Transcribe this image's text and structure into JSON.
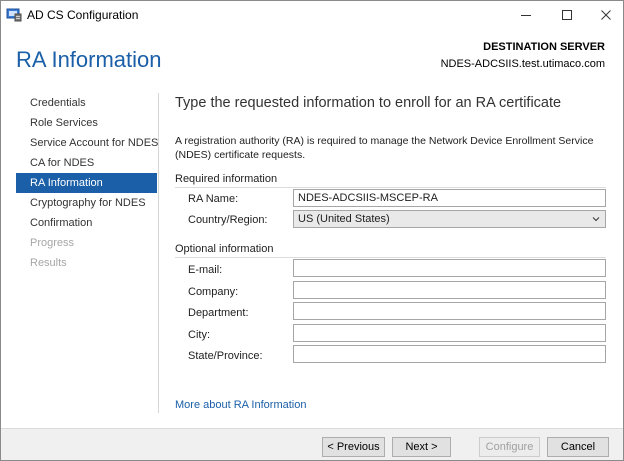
{
  "window": {
    "title": "AD CS Configuration"
  },
  "header": {
    "page_title": "RA Information",
    "destination_label": "DESTINATION SERVER",
    "destination_server": "NDES-ADCSIIS.test.utimaco.com"
  },
  "sidebar": {
    "items": [
      {
        "label": "Credentials",
        "state": "normal"
      },
      {
        "label": "Role Services",
        "state": "normal"
      },
      {
        "label": "Service Account for NDES",
        "state": "normal"
      },
      {
        "label": "CA for NDES",
        "state": "normal"
      },
      {
        "label": "RA Information",
        "state": "active"
      },
      {
        "label": "Cryptography for NDES",
        "state": "normal"
      },
      {
        "label": "Confirmation",
        "state": "normal"
      },
      {
        "label": "Progress",
        "state": "disabled"
      },
      {
        "label": "Results",
        "state": "disabled"
      }
    ]
  },
  "main": {
    "heading": "Type the requested information to enroll for an RA certificate",
    "description": "A registration authority (RA) is required to manage the Network Device Enrollment Service (NDES) certificate requests.",
    "required": {
      "section_label": "Required information",
      "ra_name_label": "RA Name:",
      "ra_name_value": "NDES-ADCSIIS-MSCEP-RA",
      "country_label": "Country/Region:",
      "country_value": "US (United States)"
    },
    "optional": {
      "section_label": "Optional information",
      "email_label": "E-mail:",
      "email_value": "",
      "company_label": "Company:",
      "company_value": "",
      "department_label": "Department:",
      "department_value": "",
      "city_label": "City:",
      "city_value": "",
      "state_label": "State/Province:",
      "state_value": ""
    },
    "more_link": "More about RA Information"
  },
  "footer": {
    "previous_label": "< Previous",
    "next_label": "Next >",
    "configure_label": "Configure",
    "cancel_label": "Cancel"
  },
  "colors": {
    "accent": "#1a5fa8",
    "disabled_text": "#a6a6a6"
  }
}
